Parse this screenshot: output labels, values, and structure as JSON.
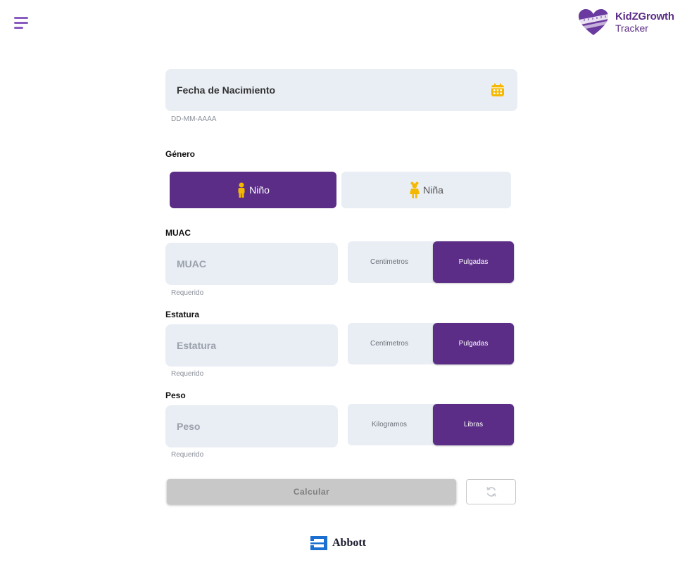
{
  "header": {
    "menu_icon": "hamburger-menu-icon",
    "logo": {
      "title": "KidZGrowth",
      "subtitle": "Tracker",
      "icon": "heart-measuring-tape-icon"
    }
  },
  "birthdate": {
    "label": "Fecha de Nacimiento",
    "format_hint": "DD-MM-AAAA",
    "icon": "calendar-icon"
  },
  "gender": {
    "label": "Género",
    "options": [
      {
        "label": "Niño",
        "icon": "boy-icon",
        "selected": true
      },
      {
        "label": "Niña",
        "icon": "girl-icon",
        "selected": false
      }
    ]
  },
  "muac": {
    "label": "MUAC",
    "placeholder": "MUAC",
    "hint": "Requerido",
    "units": [
      {
        "label": "Centimetros",
        "selected": false
      },
      {
        "label": "Pulgadas",
        "selected": true
      }
    ]
  },
  "height": {
    "label": "Estatura",
    "placeholder": "Estatura",
    "hint": "Requerido",
    "units": [
      {
        "label": "Centimetros",
        "selected": false
      },
      {
        "label": "Pulgadas",
        "selected": true
      }
    ]
  },
  "weight": {
    "label": "Peso",
    "placeholder": "Peso",
    "hint": "Requerido",
    "units": [
      {
        "label": "Kilogramos",
        "selected": false
      },
      {
        "label": "Libras",
        "selected": true
      }
    ]
  },
  "actions": {
    "calculate_label": "Calcular",
    "reset_icon": "refresh-icon"
  },
  "footer": {
    "brand": "Abbott",
    "icon": "abbott-logo-icon"
  },
  "colors": {
    "primary": "#5b2d86",
    "field_bg": "#e9edf4",
    "accent": "#f5b800",
    "disabled": "#c8c8c8"
  }
}
